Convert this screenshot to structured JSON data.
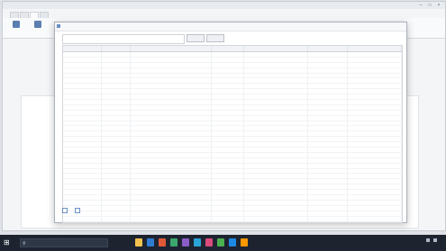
{
  "window": {
    "title": ""
  },
  "app": {
    "tabs": [
      "",
      "",
      "",
      ""
    ],
    "ribbon": [
      "",
      ""
    ],
    "left_labels": [
      "",
      ""
    ]
  },
  "dialog": {
    "title": "",
    "search_placeholder": "",
    "buttons": [
      "",
      ""
    ],
    "columns": [
      "",
      "",
      "",
      "",
      "",
      "",
      ""
    ],
    "rows": [
      [
        "",
        "",
        "",
        "",
        "",
        "",
        ""
      ],
      [
        "",
        "",
        "",
        "",
        "",
        "",
        ""
      ],
      [
        "",
        "",
        "",
        "",
        "",
        "",
        ""
      ],
      [
        "",
        "",
        "",
        "",
        "",
        "",
        ""
      ],
      [
        "",
        "",
        "",
        "",
        "",
        "",
        ""
      ],
      [
        "",
        "",
        "",
        "",
        "",
        "",
        ""
      ],
      [
        "",
        "",
        "",
        "",
        "",
        "",
        ""
      ],
      [
        "",
        "",
        "",
        "",
        "",
        "",
        ""
      ],
      [
        "",
        "",
        "",
        "",
        "",
        "",
        ""
      ],
      [
        "",
        "",
        "",
        "",
        "",
        "",
        ""
      ],
      [
        "",
        "",
        "",
        "",
        "",
        "",
        ""
      ],
      [
        "",
        "",
        "",
        "",
        "",
        "",
        ""
      ],
      [
        "",
        "",
        "",
        "",
        "",
        "",
        ""
      ],
      [
        "",
        "",
        "",
        "",
        "",
        "",
        ""
      ],
      [
        "",
        "",
        "",
        "",
        "",
        "",
        ""
      ],
      [
        "",
        "",
        "",
        "",
        "",
        "",
        ""
      ],
      [
        "",
        "",
        "",
        "",
        "",
        "",
        ""
      ],
      [
        "",
        "",
        "",
        "",
        "",
        "",
        ""
      ],
      [
        "",
        "",
        "",
        "",
        "",
        "",
        ""
      ],
      [
        "",
        "",
        "",
        "",
        "",
        "",
        ""
      ],
      [
        "",
        "",
        "",
        "",
        "",
        "",
        ""
      ],
      [
        "",
        "",
        "",
        "",
        "",
        "",
        ""
      ],
      [
        "",
        "",
        "",
        "",
        "",
        "",
        ""
      ],
      [
        "",
        "",
        "",
        "",
        "",
        "",
        ""
      ],
      [
        "",
        "",
        "",
        "",
        "",
        "",
        ""
      ],
      [
        "",
        "",
        "",
        "",
        "",
        "",
        ""
      ],
      [
        "",
        "",
        "",
        "",
        "",
        "",
        ""
      ],
      [
        "",
        "",
        "",
        "",
        "",
        "",
        ""
      ],
      [
        "",
        "",
        "",
        "",
        "",
        "",
        ""
      ],
      [
        "",
        "",
        "",
        "",
        "",
        "",
        ""
      ],
      [
        "",
        "",
        "",
        "",
        "",
        "",
        ""
      ],
      [
        "",
        "",
        "",
        "",
        "",
        "",
        ""
      ],
      [
        "",
        "",
        "",
        "",
        "",
        "",
        ""
      ],
      [
        "",
        "",
        "",
        "",
        "",
        "",
        ""
      ],
      [
        "",
        "",
        "",
        "",
        "",
        "",
        ""
      ]
    ],
    "group_starts": [
      0,
      3,
      10,
      17,
      22,
      27,
      31
    ],
    "footer": [
      "",
      ""
    ]
  },
  "taskbar": {
    "search_placeholder": "",
    "app_colors": [
      "#f2c14e",
      "#2f7cd3",
      "#e05a3a",
      "#3aa76d",
      "#8a5cc8",
      "#2aa3d8",
      "#d94a7a",
      "#4caf50",
      "#1e88e5",
      "#ff9800"
    ],
    "clock_time": "",
    "clock_date": ""
  },
  "colors": {
    "accent": "#5b7fb0",
    "taskbar": "#1d2430"
  }
}
